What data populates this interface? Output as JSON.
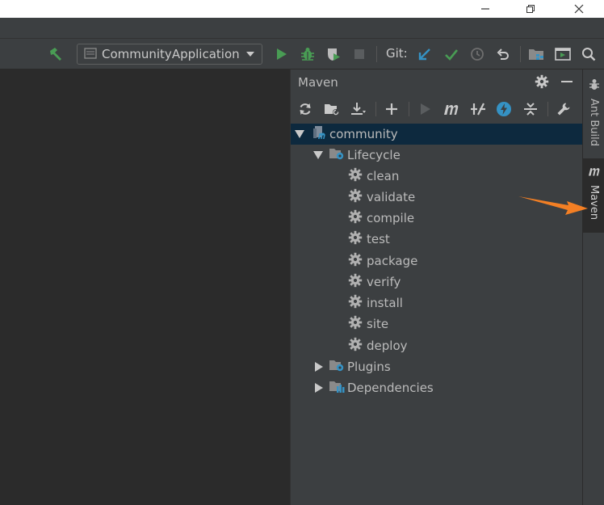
{
  "window": {
    "minimize_icon": "minimize-icon",
    "maximize_icon": "restore-icon",
    "close_icon": "close-icon"
  },
  "toolbar": {
    "run_config": "CommunityApplication",
    "git_label": "Git:"
  },
  "maven": {
    "title": "Maven",
    "tree": [
      {
        "label": "community",
        "icon": "maven-module-icon",
        "expanded": true,
        "level": 0
      },
      {
        "label": "Lifecycle",
        "icon": "lifecycle-folder-icon",
        "expanded": true,
        "level": 1
      },
      {
        "label": "clean",
        "icon": "gear-icon",
        "level": 2
      },
      {
        "label": "validate",
        "icon": "gear-icon",
        "level": 2
      },
      {
        "label": "compile",
        "icon": "gear-icon",
        "level": 2
      },
      {
        "label": "test",
        "icon": "gear-icon",
        "level": 2
      },
      {
        "label": "package",
        "icon": "gear-icon",
        "level": 2
      },
      {
        "label": "verify",
        "icon": "gear-icon",
        "level": 2
      },
      {
        "label": "install",
        "icon": "gear-icon",
        "level": 2
      },
      {
        "label": "site",
        "icon": "gear-icon",
        "level": 2
      },
      {
        "label": "deploy",
        "icon": "gear-icon",
        "level": 2
      },
      {
        "label": "Plugins",
        "icon": "plugins-folder-icon",
        "expanded": false,
        "level": 1
      },
      {
        "label": "Dependencies",
        "icon": "dependencies-folder-icon",
        "expanded": false,
        "level": 1
      }
    ]
  },
  "side_tabs": {
    "ant": "Ant Build",
    "maven": "Maven"
  },
  "colors": {
    "accent_green": "#499c54",
    "accent_blue": "#3592c4",
    "annotation_orange": "#f37f24",
    "selection": "#0d293e"
  }
}
